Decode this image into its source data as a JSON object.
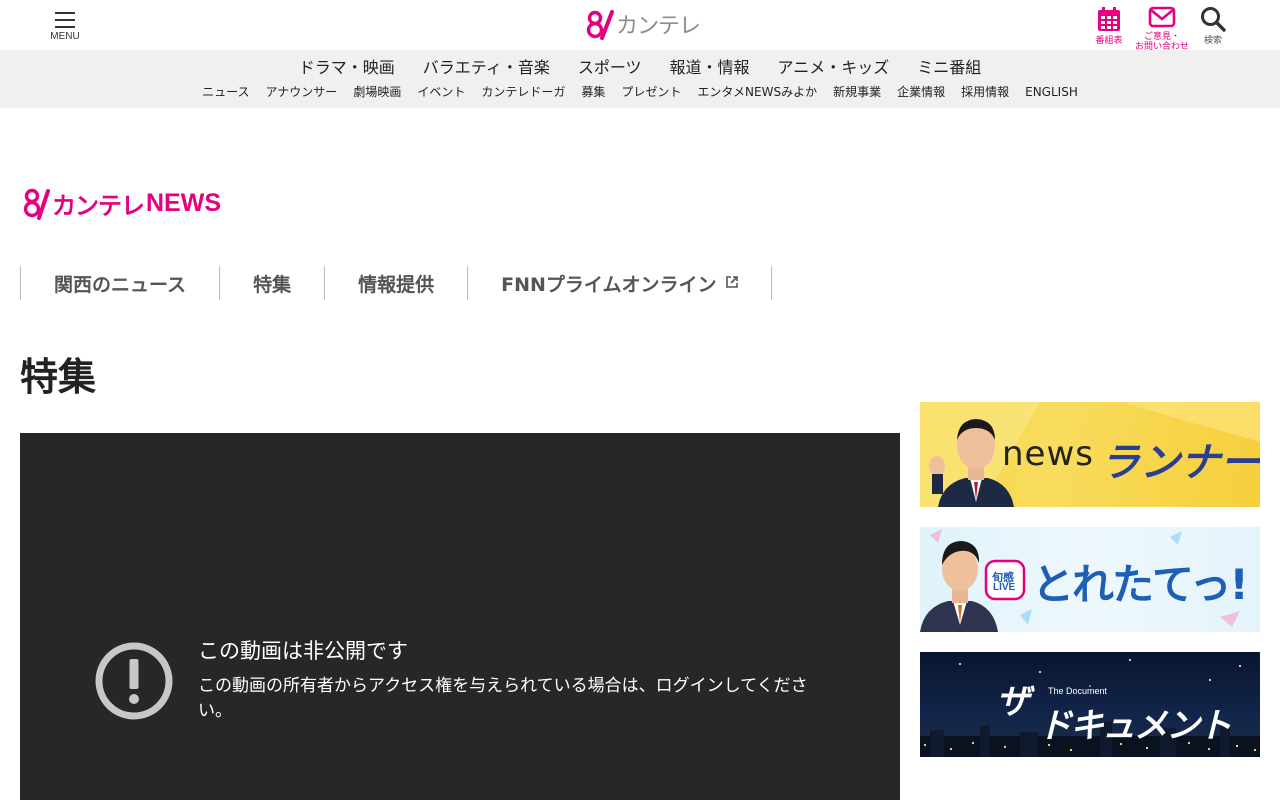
{
  "header": {
    "menu_label": "MENU",
    "logo_text": "カンテレ",
    "schedule_label": "番組表",
    "contact_label_1": "ご意見・",
    "contact_label_2": "お問い合わせ",
    "search_label": "検索"
  },
  "nav": {
    "main": [
      "ドラマ・映画",
      "バラエティ・音楽",
      "スポーツ",
      "報道・情報",
      "アニメ・キッズ",
      "ミニ番組"
    ],
    "sub": [
      "ニュース",
      "アナウンサー",
      "劇場映画",
      "イベント",
      "カンテレドーガ",
      "募集",
      "プレゼント",
      "エンタメNEWSみよか",
      "新規事業",
      "企業情報",
      "採用情報",
      "ENGLISH"
    ]
  },
  "news_logo": {
    "kantele": "カンテレ",
    "news": "NEWS"
  },
  "tabs": [
    "関西のニュース",
    "特集",
    "情報提供",
    "FNNプライムオンライン"
  ],
  "page_title": "特集",
  "video": {
    "error_title": "この動画は非公開です",
    "error_message": "この動画の所有者からアクセス権を与えられている場合は、ログインしてください。"
  },
  "banners": {
    "runner": {
      "word1": "news",
      "word2": "ランナー"
    },
    "toretate": {
      "badge_1": "旬感",
      "badge_2": "LIVE",
      "title": "とれたてっ!"
    },
    "document": {
      "the": "The Document",
      "title_1": "ザ",
      "title_2": "ドキュメント"
    }
  },
  "colors": {
    "brand_pink": "#e4007f",
    "nav_bg": "#f0f0f0",
    "player_bg": "#272727"
  }
}
